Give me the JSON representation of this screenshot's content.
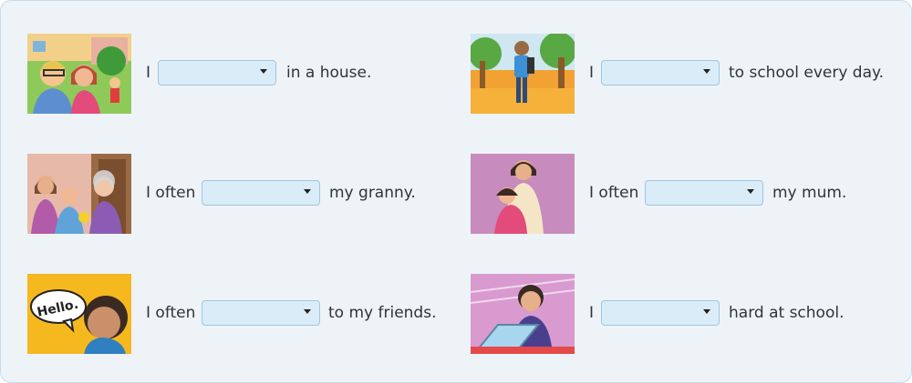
{
  "exercise": {
    "rows": [
      {
        "before": "I",
        "selected": "",
        "after": "in a house.",
        "illustration": "family-house-illustration"
      },
      {
        "before": "I",
        "selected": "",
        "after": "to school every day.",
        "illustration": "boy-walking-illustration"
      },
      {
        "before": "I often",
        "selected": "",
        "after": "my granny.",
        "illustration": "visiting-granny-illustration"
      },
      {
        "before": "I often",
        "selected": "",
        "after": "my mum.",
        "illustration": "hugging-mum-illustration"
      },
      {
        "before": "I often",
        "selected": "",
        "after": "to my friends.",
        "illustration": "hello-speech-illustration"
      },
      {
        "before": "I",
        "selected": "",
        "after": "hard at school.",
        "illustration": "girl-at-computer-illustration"
      }
    ],
    "speech_bubble": "Hello."
  },
  "colors": {
    "panel_bg": "#eef3f8",
    "select_bg": "#d9ecf8",
    "select_border": "#9fc6e2"
  }
}
